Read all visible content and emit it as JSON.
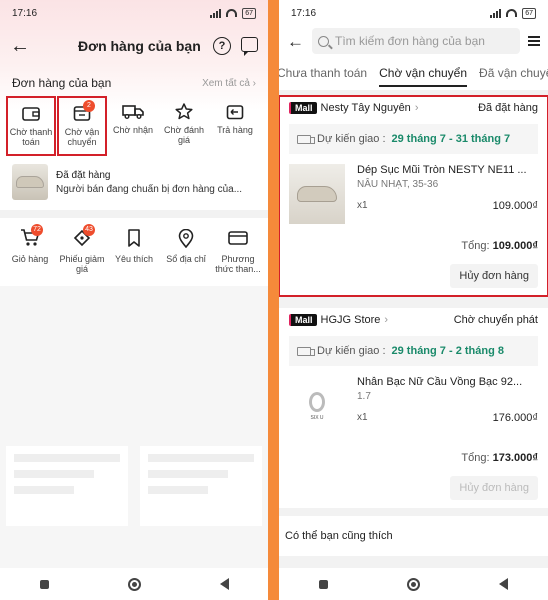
{
  "left": {
    "status_bar": {
      "time": "17:16",
      "battery": "67"
    },
    "header": {
      "title": "Đơn hàng của bạn"
    },
    "orders_section": {
      "title": "Đơn hàng của bạn",
      "see_all": "Xem tất cả"
    },
    "statuses": [
      {
        "label": "Chờ thanh toán",
        "icon": "wallet-icon",
        "badge": ""
      },
      {
        "label": "Chờ vận chuyển",
        "icon": "package-icon",
        "badge": "2"
      },
      {
        "label": "Chờ nhận",
        "icon": "truck-icon",
        "badge": ""
      },
      {
        "label": "Chờ đánh giá",
        "icon": "star-icon",
        "badge": ""
      },
      {
        "label": "Trả hàng",
        "icon": "return-box-icon",
        "badge": ""
      }
    ],
    "latest_order": {
      "status": "Đã đặt hàng",
      "desc": "Người bán đang chuẩn bị đơn hàng của..."
    },
    "utilities": [
      {
        "label": "Giỏ hàng",
        "icon": "cart-icon",
        "badge": "72"
      },
      {
        "label": "Phiếu giảm giá",
        "icon": "voucher-icon",
        "badge": "43"
      },
      {
        "label": "Yêu thích",
        "icon": "bookmark-icon",
        "badge": ""
      },
      {
        "label": "Sổ địa chỉ",
        "icon": "location-pin-icon",
        "badge": ""
      },
      {
        "label": "Phương thức than...",
        "icon": "card-icon",
        "badge": ""
      }
    ]
  },
  "right": {
    "status_bar": {
      "time": "17:16",
      "battery": "67"
    },
    "search": {
      "placeholder": "Tìm kiếm đơn hàng của bạn"
    },
    "tabs": [
      "Chưa thanh toán",
      "Chờ vận chuyển",
      "Đã vận chuyển"
    ],
    "active_tab": "Chờ vận chuyển",
    "orders": [
      {
        "mall": "Mall",
        "shop": "Nesty Tây Nguyên",
        "status": "Đã đặt hàng",
        "delivery_label": "Dự kiến giao :",
        "delivery_dates": "29 tháng 7 - 31 tháng 7",
        "product_name": "Dép Sục Mũi Tròn NESTY NE11 ...",
        "variant": "NÂU NHẠT, 35-36",
        "qty": "x1",
        "price": "109.000₫",
        "total_label": "Tổng:",
        "total": "109.000₫",
        "button": "Hủy đơn hàng"
      },
      {
        "mall": "Mall",
        "shop": "HGJG Store",
        "status": "Chờ chuyển phát",
        "delivery_label": "Dự kiến giao :",
        "delivery_dates": "29 tháng 7 - 2 tháng 8",
        "product_name": "Nhẫn Bạc Nữ Cầu Vồng Bạc 92...",
        "variant": "1.7",
        "qty": "x1",
        "price": "176.000₫",
        "total_label": "Tổng:",
        "total": "173.000₫",
        "button": "Hủy đơn hàng",
        "ring_caption": "SIX U"
      }
    ],
    "suggestion": "Có thể bạn cũng thích"
  },
  "colors": {
    "highlight": "#d32029",
    "accent_green": "#1a8a6a",
    "badge": "#ee4d2d",
    "divider": "#f58a3a"
  }
}
